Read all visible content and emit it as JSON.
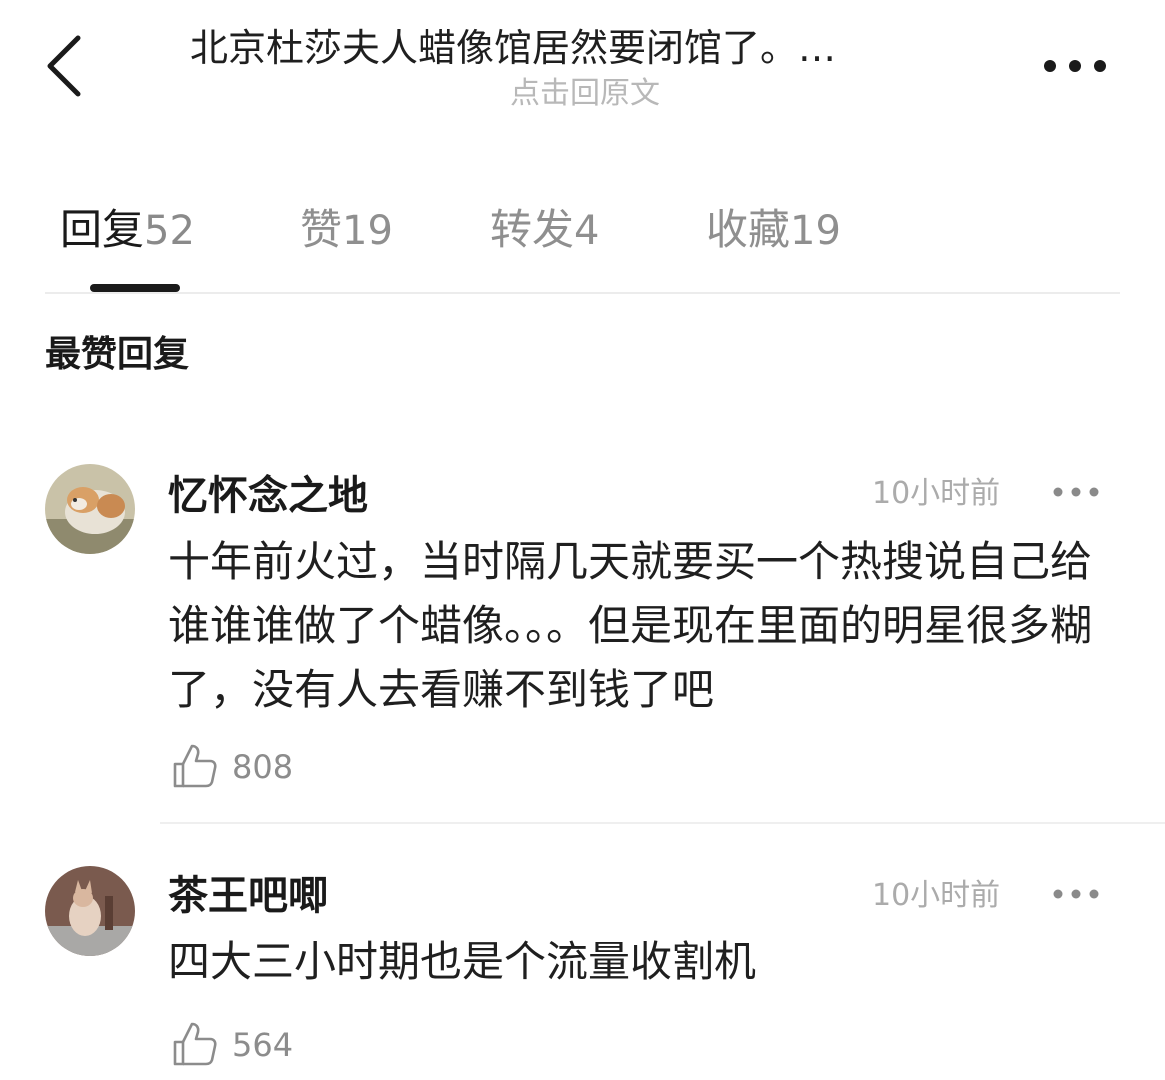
{
  "header": {
    "title": "北京杜莎夫人蜡像馆居然要闭馆了。…",
    "subtitle": "点击回原文"
  },
  "tabs": [
    {
      "label": "回复",
      "count": "52",
      "active": true
    },
    {
      "label": "赞",
      "count": "19",
      "active": false
    },
    {
      "label": "转发",
      "count": "4",
      "active": false
    },
    {
      "label": "收藏",
      "count": "19",
      "active": false
    }
  ],
  "section_title": "最赞回复",
  "comments": [
    {
      "username": "忆怀念之地",
      "time": "10小时前",
      "text": "十年前火过，当时隔几天就要买一个热搜说自己给谁谁谁做了个蜡像。。。但是现在里面的明星很多糊了，没有人去看赚不到钱了吧",
      "likes": "808"
    },
    {
      "username": "茶王吧唧",
      "time": "10小时前",
      "text": "四大三小时期也是个流量收割机",
      "likes": "564"
    }
  ],
  "colors": {
    "text_primary": "#1a1a1a",
    "text_muted": "#8f8f8f",
    "time": "#ababab",
    "divider": "#ececec",
    "indicator": "#1a1a1a"
  },
  "icons": {
    "back": "chevron-left-icon",
    "more": "ellipsis-icon",
    "like": "thumbs-up-icon"
  }
}
